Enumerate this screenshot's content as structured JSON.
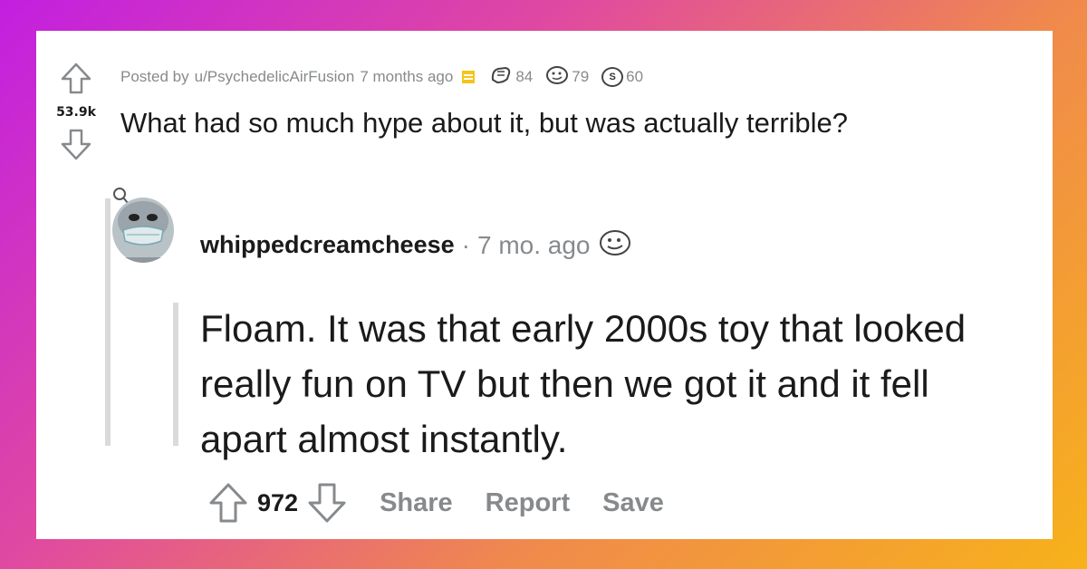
{
  "post": {
    "meta_prefix": "Posted by",
    "author": "u/PsychedelicAirFusion",
    "time": "7 months ago",
    "awards": [
      {
        "icon": "fist-award-icon",
        "count": "84"
      },
      {
        "icon": "face-award-icon",
        "count": "79"
      },
      {
        "icon": "coin-award-icon",
        "glyph": "S",
        "count": "60"
      }
    ],
    "score": "53.9k",
    "title": "What had so much hype about it, but was actually terrible?"
  },
  "comment": {
    "author": "whippedcreamcheese",
    "separator": "·",
    "time": "7 mo. ago",
    "body": "Floam. It was that early 2000s toy that looked really fun on TV but then we got it and it fell apart almost instantly.",
    "score": "972",
    "actions": {
      "share": "Share",
      "report": "Report",
      "save": "Save"
    }
  },
  "colors": {
    "text": "#1a1a1b",
    "muted": "#878a8c",
    "thread_line": "#dadada",
    "flair": "#f5c518"
  }
}
